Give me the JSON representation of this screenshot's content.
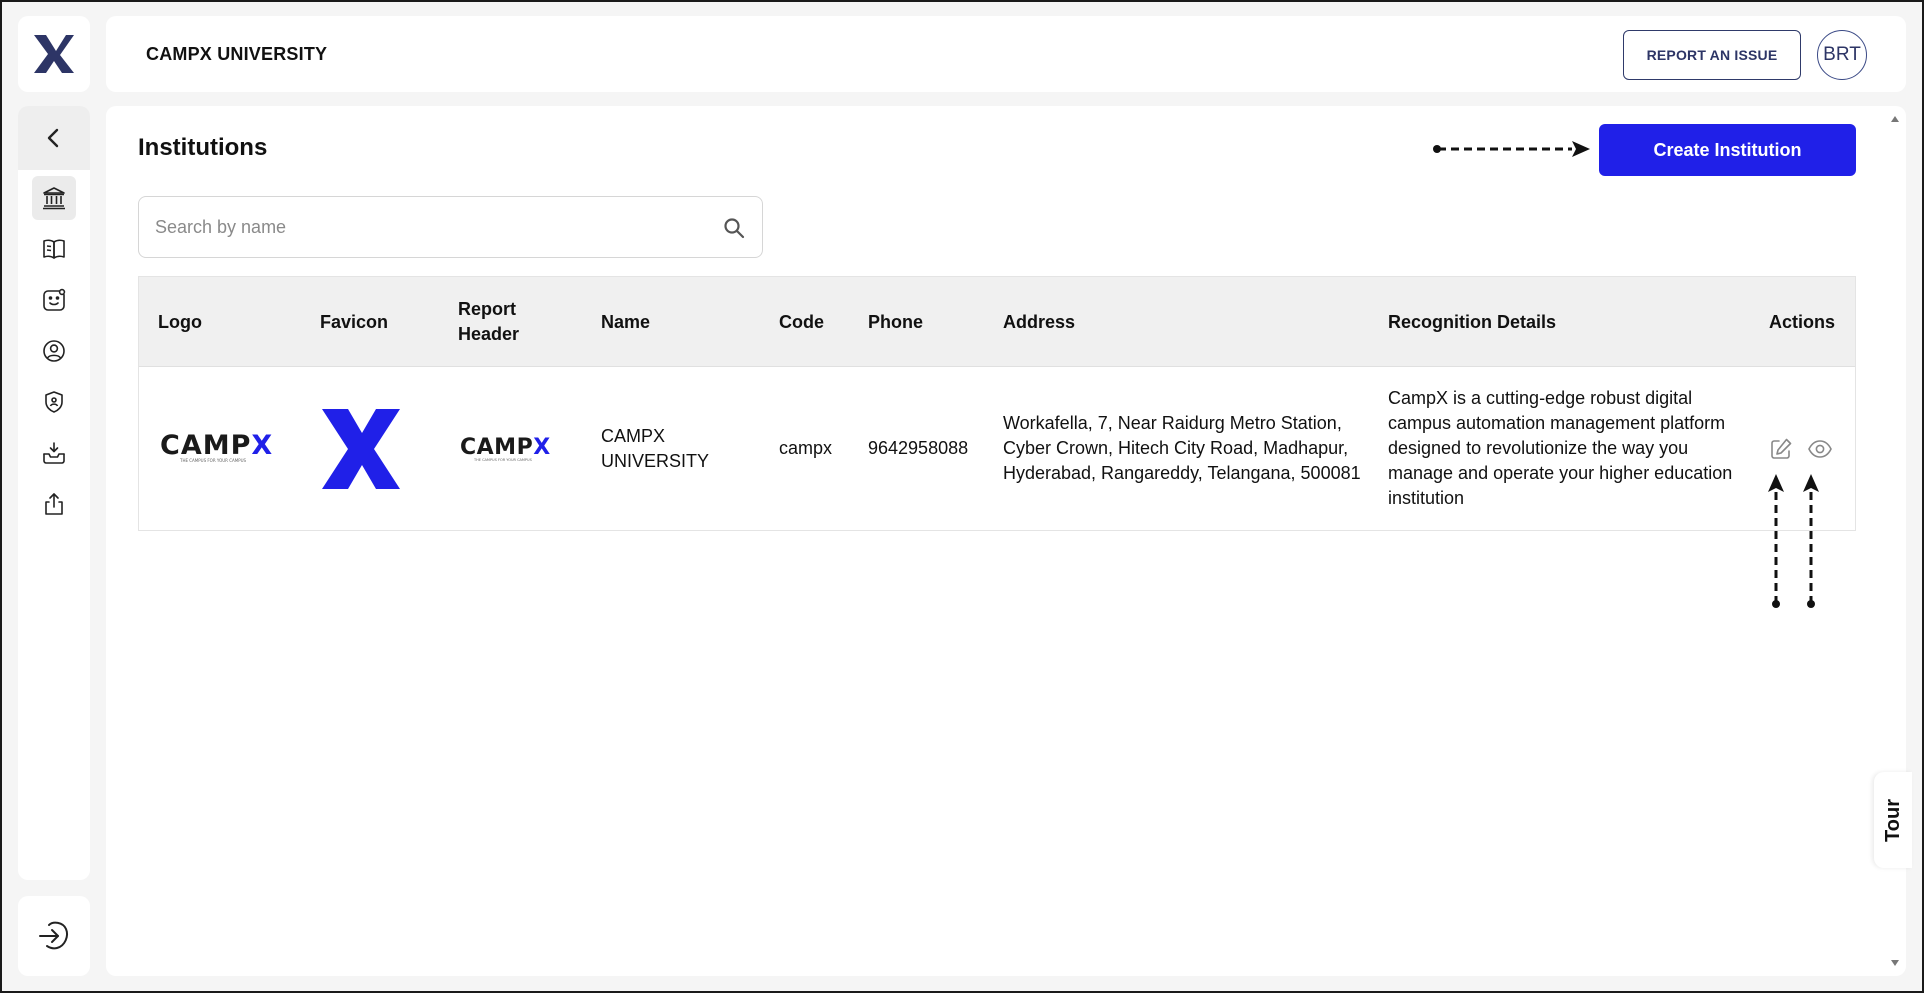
{
  "app": {
    "brand_letter": "X",
    "accent_color": "#2020e8",
    "navy_color": "#2d3566"
  },
  "header": {
    "title": "CAMPX UNIVERSITY",
    "report_button": "REPORT AN ISSUE",
    "avatar_initials": "BRT"
  },
  "sidebar": {
    "items": [
      {
        "icon": "institution-icon",
        "active": true
      },
      {
        "icon": "book-icon",
        "active": false
      },
      {
        "icon": "id-card-icon",
        "active": false
      },
      {
        "icon": "user-circle-icon",
        "active": false
      },
      {
        "icon": "shield-user-icon",
        "active": false
      },
      {
        "icon": "inbox-download-icon",
        "active": false
      },
      {
        "icon": "upload-icon",
        "active": false
      }
    ]
  },
  "main": {
    "page_title": "Institutions",
    "create_button": "Create Institution",
    "search": {
      "placeholder": "Search by name",
      "value": ""
    },
    "table": {
      "columns": [
        "Logo",
        "Favicon",
        "Report Header",
        "Name",
        "Code",
        "Phone",
        "Address",
        "Recognition Details",
        "Actions"
      ],
      "rows": [
        {
          "logo_text": "CAMPX",
          "report_header_text": "CAMPX",
          "name": "CAMPX UNIVERSITY",
          "code": "campx",
          "phone": "9642958088",
          "address": "Workafella, 7, Near Raidurg Metro Station, Cyber Crown, Hitech City Road, Madhapur, Hyderabad, Rangareddy, Telangana, 500081",
          "recognition_details": "CampX is a cutting-edge robust digital campus automation management platform designed to revolutionize the way you manage and operate your higher education institution",
          "actions": [
            "edit-icon",
            "view-icon"
          ]
        }
      ]
    }
  },
  "tour": {
    "label": "Tour"
  }
}
